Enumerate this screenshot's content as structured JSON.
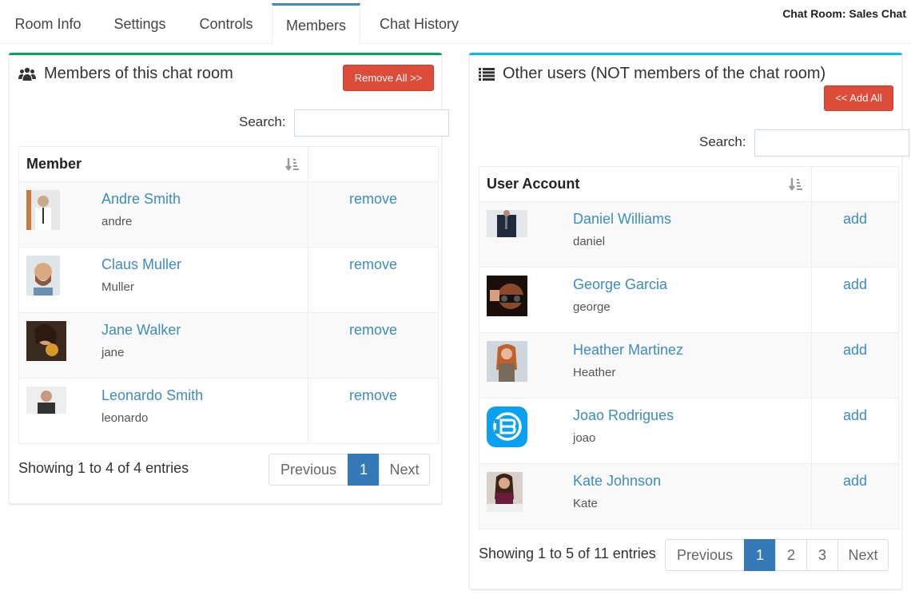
{
  "tabs": [
    {
      "label": "Room Info"
    },
    {
      "label": "Settings"
    },
    {
      "label": "Controls"
    },
    {
      "label": "Members",
      "active": true
    },
    {
      "label": "Chat History"
    }
  ],
  "room_title": "Chat Room: Sales Chat",
  "members_box": {
    "title": "Members of this chat room",
    "icon": "users-icon",
    "accent": "#00a65a",
    "button": "Remove All >>",
    "search_label": "Search:",
    "search_value": "",
    "column": "Member",
    "action_label": "remove",
    "rows": [
      {
        "name": "Andre Smith",
        "username": "andre"
      },
      {
        "name": "Claus Muller",
        "username": "Muller"
      },
      {
        "name": "Jane Walker",
        "username": "jane"
      },
      {
        "name": "Leonardo Smith",
        "username": "leonardo"
      }
    ],
    "info": "Showing 1 to 4 of 4 entries",
    "pages": [
      "Previous",
      "1",
      "Next"
    ],
    "current_page": "1"
  },
  "others_box": {
    "title": "Other users (NOT members of the chat room)",
    "icon": "list-icon",
    "accent": "#00c0ef",
    "button": "<< Add All",
    "search_label": "Search:",
    "search_value": "",
    "column": "User Account",
    "action_label": "add",
    "rows": [
      {
        "name": "Daniel Williams",
        "username": "daniel"
      },
      {
        "name": "George Garcia",
        "username": "george"
      },
      {
        "name": "Heather Martinez",
        "username": "Heather"
      },
      {
        "name": "Joao Rodrigues",
        "username": "joao"
      },
      {
        "name": "Kate Johnson",
        "username": "Kate"
      }
    ],
    "info": "Showing 1 to 5 of 11 entries",
    "pages": [
      "Previous",
      "1",
      "2",
      "3",
      "Next"
    ],
    "current_page": "1"
  }
}
